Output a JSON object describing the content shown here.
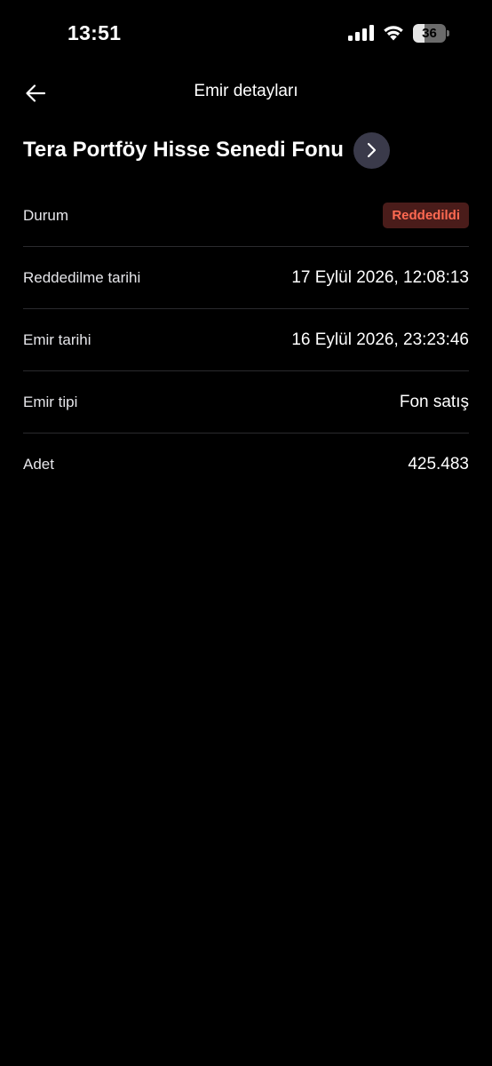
{
  "status_bar": {
    "time": "13:51",
    "battery_level": "36",
    "battery_fraction": 0.36,
    "icons": [
      "cellular-signal-icon",
      "wifi-icon",
      "battery-icon"
    ]
  },
  "nav": {
    "title": "Emir detayları",
    "back_icon": "arrow-left-icon"
  },
  "fund": {
    "name": "Tera Portföy Hisse Senedi Fonu",
    "arrow_icon": "chevron-right-icon"
  },
  "details": {
    "status": {
      "label": "Durum",
      "value": "Reddedildi"
    },
    "rejection_date": {
      "label": "Reddedilme tarihi",
      "value": "17 Eylül 2026, 12:08:13"
    },
    "order_date": {
      "label": "Emir tarihi",
      "value": "16 Eylül 2026, 23:23:46"
    },
    "order_type": {
      "label": "Emir tipi",
      "value": "Fon satış"
    },
    "quantity": {
      "label": "Adet",
      "value": "425.483"
    }
  },
  "colors": {
    "background": "#000000",
    "text": "#ffffff",
    "divider": "#2a2a2e",
    "badge_background": "#4a1c1a",
    "badge_text": "#ff6a52",
    "circle_button": "#3a3a4a"
  }
}
